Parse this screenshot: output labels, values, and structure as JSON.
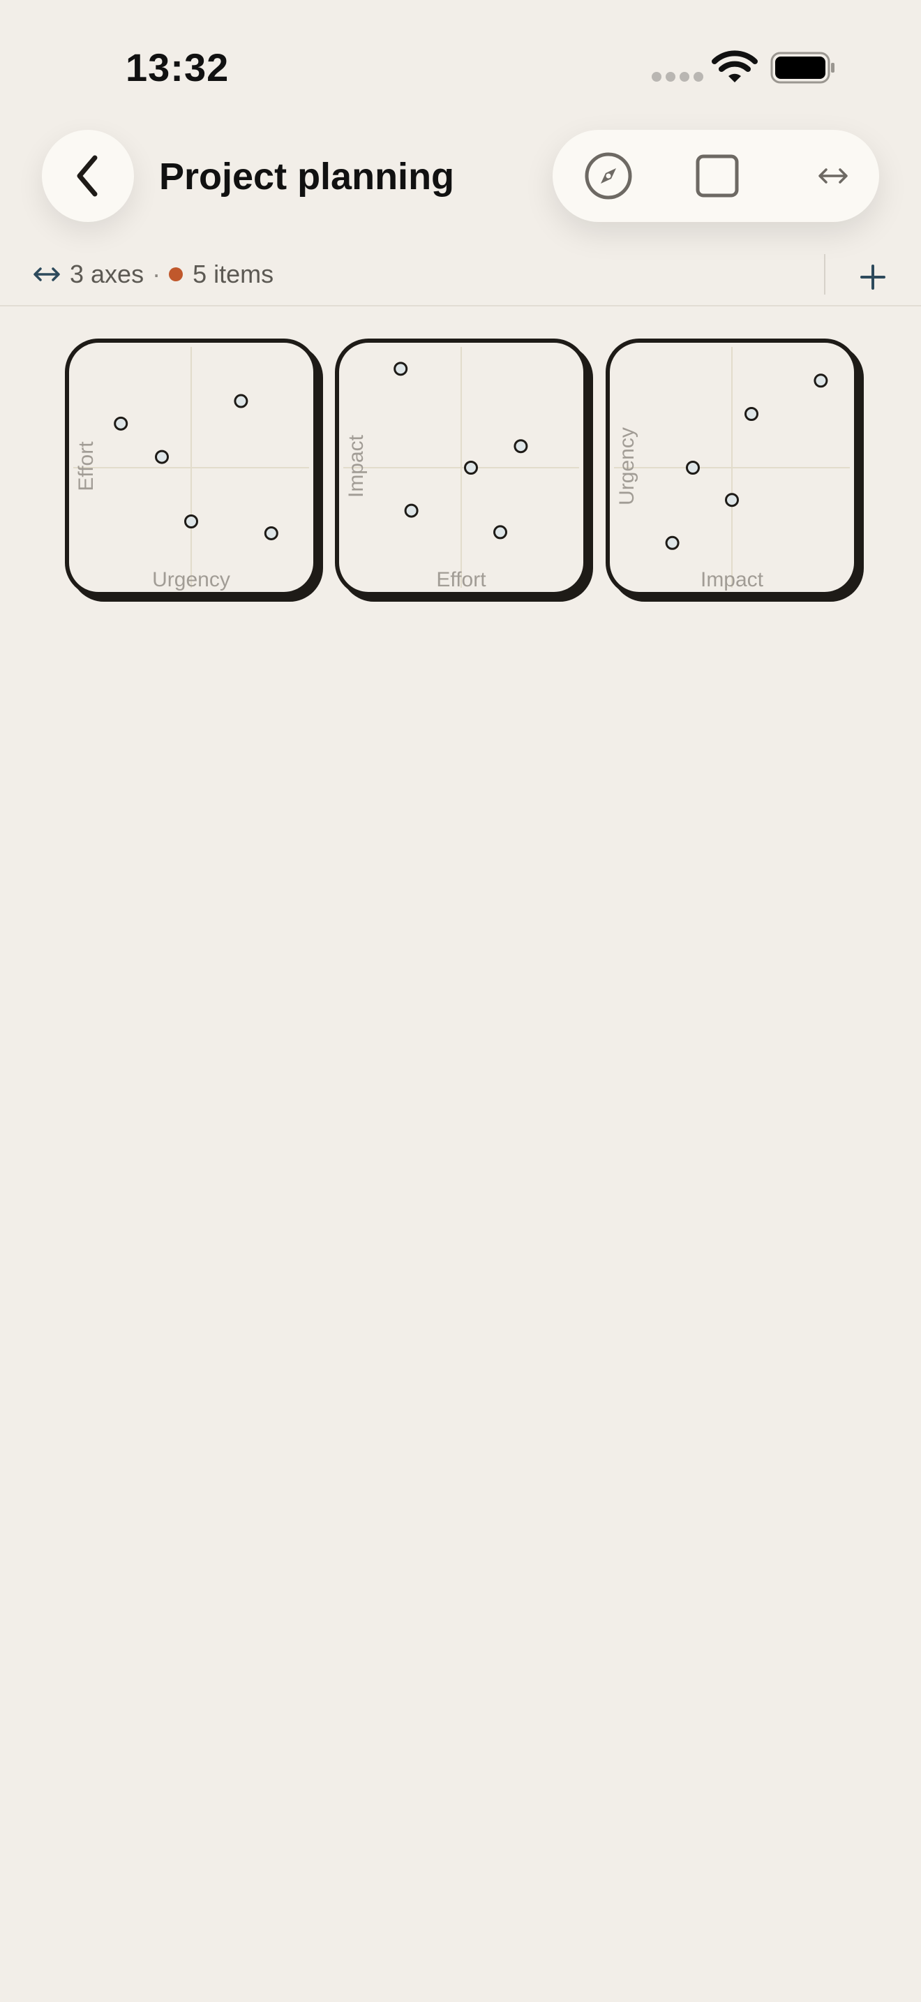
{
  "status_bar": {
    "time": "13:32"
  },
  "header": {
    "title": "Project planning"
  },
  "toolbar": {
    "icons": [
      "compass-icon",
      "square-icon",
      "arrows-horizontal-icon"
    ]
  },
  "summary": {
    "axes_text": "3 axes",
    "separator": "·",
    "items_text": "5 items",
    "dot_color": "#c0582c"
  },
  "chart_data": [
    {
      "type": "scatter",
      "xlabel": "Urgency",
      "ylabel": "Effort",
      "xlim": [
        -1,
        1
      ],
      "ylim": [
        -1,
        1
      ],
      "points": [
        {
          "x": -0.72,
          "y": 0.41
        },
        {
          "x": -0.3,
          "y": 0.1
        },
        {
          "x": 0.51,
          "y": 0.62
        },
        {
          "x": 0.0,
          "y": -0.5
        },
        {
          "x": 0.82,
          "y": -0.61
        }
      ]
    },
    {
      "type": "scatter",
      "xlabel": "Effort",
      "ylabel": "Impact",
      "xlim": [
        -1,
        1
      ],
      "ylim": [
        -1,
        1
      ],
      "points": [
        {
          "x": -0.62,
          "y": 0.92
        },
        {
          "x": 0.61,
          "y": 0.2
        },
        {
          "x": 0.1,
          "y": 0.0
        },
        {
          "x": -0.51,
          "y": -0.4
        },
        {
          "x": 0.4,
          "y": -0.6
        }
      ]
    },
    {
      "type": "scatter",
      "xlabel": "Impact",
      "ylabel": "Urgency",
      "xlim": [
        -1,
        1
      ],
      "ylim": [
        -1,
        1
      ],
      "points": [
        {
          "x": 0.91,
          "y": 0.81
        },
        {
          "x": 0.2,
          "y": 0.5
        },
        {
          "x": -0.4,
          "y": 0.0
        },
        {
          "x": 0.0,
          "y": -0.3
        },
        {
          "x": -0.61,
          "y": -0.7
        }
      ]
    }
  ],
  "colors": {
    "background": "#f2eee8",
    "card_border": "#1e1b17",
    "point_fill": "#dfe6e8",
    "grid": "#e2dccb",
    "accent": "#2d4a5c"
  }
}
